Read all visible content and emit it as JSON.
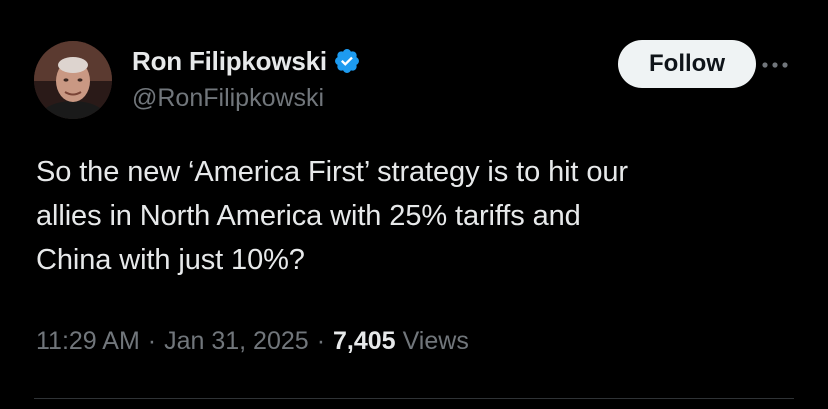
{
  "author": {
    "display_name": "Ron Filipkowski",
    "handle": "@RonFilipkowski",
    "verified": true,
    "verified_color": "#1d9bf0"
  },
  "actions": {
    "follow_label": "Follow",
    "more_icon": "more-horizontal-icon"
  },
  "tweet": {
    "lines": [
      "So the new ‘America First’ strategy is to hit our",
      "allies in North America with 25% tariffs and",
      "China with just 10%?"
    ]
  },
  "meta": {
    "time": "11:29 AM",
    "separator": "·",
    "date": "Jan 31, 2025",
    "views_count": "7,405",
    "views_label": "Views"
  },
  "colors": {
    "background": "#000000",
    "text_primary": "#e7e9ea",
    "text_secondary": "#71767b",
    "follow_bg": "#eff3f4",
    "divider": "#2f3336"
  }
}
